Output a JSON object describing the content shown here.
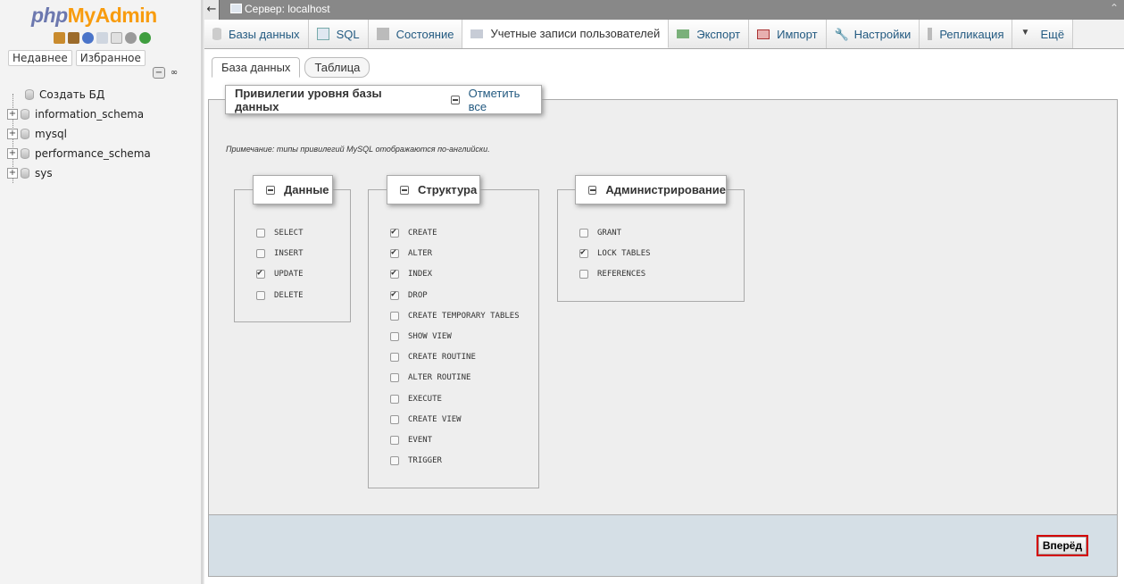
{
  "app": {
    "logo_php": "php",
    "logo_my": "MyAdmin"
  },
  "sidebar": {
    "recent_label": "Недавнее",
    "favorites_label": "Избранное",
    "create_db": "Создать БД",
    "databases": [
      "information_schema",
      "mysql",
      "performance_schema",
      "sys"
    ]
  },
  "topbar": {
    "server": "Сервер: localhost"
  },
  "tabs": [
    {
      "label": "Базы данных",
      "icon": "database-icon"
    },
    {
      "label": "SQL",
      "icon": "sql-icon"
    },
    {
      "label": "Состояние",
      "icon": "status-icon"
    },
    {
      "label": "Учетные записи пользователей",
      "icon": "users-icon",
      "active": true
    },
    {
      "label": "Экспорт",
      "icon": "export-icon"
    },
    {
      "label": "Импорт",
      "icon": "import-icon"
    },
    {
      "label": "Настройки",
      "icon": "wrench-icon"
    },
    {
      "label": "Репликация",
      "icon": "replication-icon"
    },
    {
      "label": "Ещё",
      "icon": "chevron-down-icon"
    }
  ],
  "subtabs": {
    "database": "База данных",
    "table": "Таблица"
  },
  "privileges": {
    "title": "Привилегии уровня базы данных",
    "check_all": "Отметить все",
    "note": "Примечание: типы привилегий MySQL отображаются по-английски.",
    "data_group": {
      "label": "Данные",
      "items": [
        {
          "name": "SELECT",
          "checked": false
        },
        {
          "name": "INSERT",
          "checked": false
        },
        {
          "name": "UPDATE",
          "checked": true
        },
        {
          "name": "DELETE",
          "checked": false
        }
      ]
    },
    "structure_group": {
      "label": "Структура",
      "items": [
        {
          "name": "CREATE",
          "checked": true
        },
        {
          "name": "ALTER",
          "checked": true
        },
        {
          "name": "INDEX",
          "checked": true
        },
        {
          "name": "DROP",
          "checked": true
        },
        {
          "name": "CREATE TEMPORARY TABLES",
          "checked": false
        },
        {
          "name": "SHOW VIEW",
          "checked": false
        },
        {
          "name": "CREATE ROUTINE",
          "checked": false
        },
        {
          "name": "ALTER ROUTINE",
          "checked": false
        },
        {
          "name": "EXECUTE",
          "checked": false
        },
        {
          "name": "CREATE VIEW",
          "checked": false
        },
        {
          "name": "EVENT",
          "checked": false
        },
        {
          "name": "TRIGGER",
          "checked": false
        }
      ]
    },
    "admin_group": {
      "label": "Администрирование",
      "items": [
        {
          "name": "GRANT",
          "checked": false
        },
        {
          "name": "LOCK TABLES",
          "checked": true
        },
        {
          "name": "REFERENCES",
          "checked": false
        }
      ]
    }
  },
  "footer": {
    "next_button": "Вперёд"
  }
}
